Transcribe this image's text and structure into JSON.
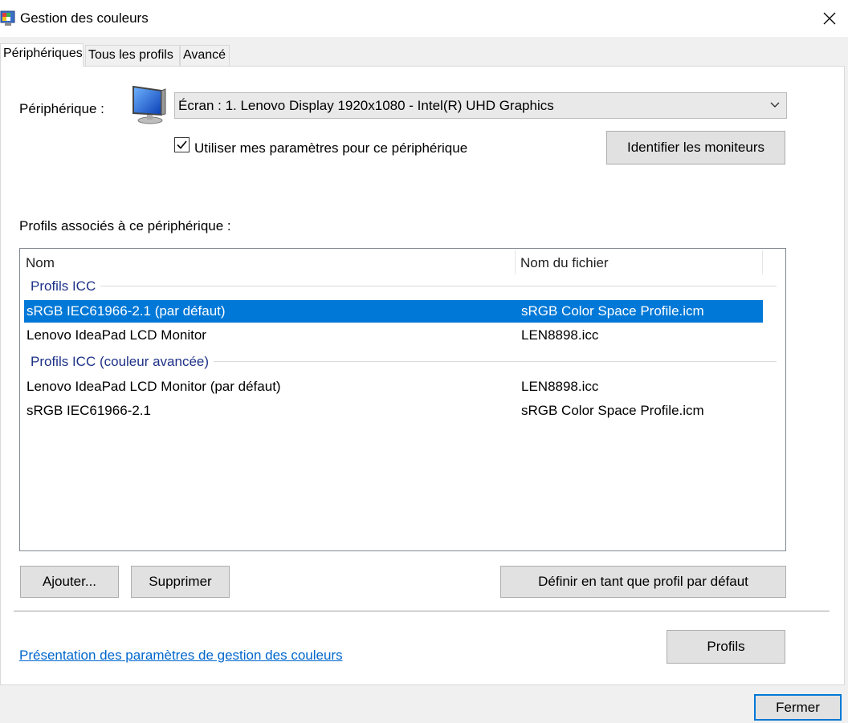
{
  "window": {
    "title": "Gestion des couleurs",
    "icon": "color-management-icon",
    "close_icon": "close-icon"
  },
  "tabs": [
    {
      "label": "Périphériques",
      "active": true
    },
    {
      "label": "Tous les profils",
      "active": false
    },
    {
      "label": "Avancé",
      "active": false
    }
  ],
  "device": {
    "label": "Périphérique :",
    "icon": "monitor-icon",
    "selected": "Écran : 1. Lenovo Display 1920x1080 - Intel(R) UHD Graphics",
    "use_my_settings_label": "Utiliser mes paramètres pour ce périphérique",
    "use_my_settings_checked": true,
    "identify_button": "Identifier les moniteurs"
  },
  "profiles": {
    "section_label": "Profils associés à ce périphérique :",
    "columns": [
      "Nom",
      "Nom du fichier"
    ],
    "groups": [
      {
        "header": "Profils ICC",
        "rows": [
          {
            "name": "sRGB IEC61966-2.1 (par défaut)",
            "file": "sRGB Color Space Profile.icm",
            "selected": true
          },
          {
            "name": "Lenovo IdeaPad LCD Monitor",
            "file": "LEN8898.icc",
            "selected": false
          }
        ]
      },
      {
        "header": "Profils ICC (couleur avancée)",
        "rows": [
          {
            "name": "Lenovo IdeaPad LCD Monitor (par défaut)",
            "file": "LEN8898.icc",
            "selected": false
          },
          {
            "name": "sRGB IEC61966-2.1",
            "file": "sRGB Color Space Profile.icm",
            "selected": false
          }
        ]
      }
    ]
  },
  "buttons": {
    "add": "Ajouter...",
    "remove": "Supprimer",
    "set_default": "Définir en tant que profil par défaut",
    "profiles": "Profils",
    "close": "Fermer"
  },
  "link": "Présentation des paramètres de gestion des couleurs",
  "colors": {
    "selection": "#0078d7",
    "group_header": "#1e3287",
    "link": "#0066cc"
  }
}
